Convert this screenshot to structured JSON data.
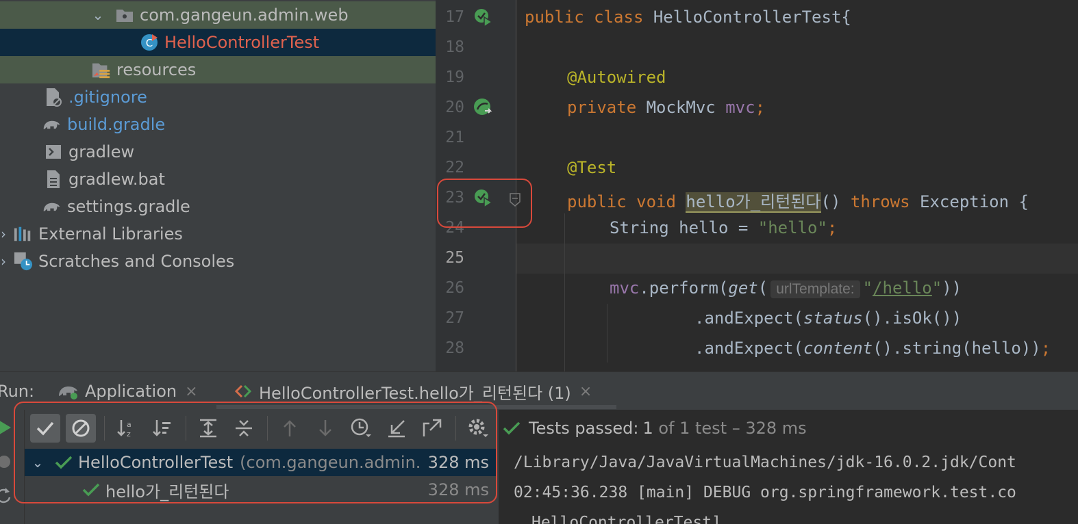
{
  "project_tree": {
    "items": [
      {
        "label": "com.gangeun.admin.web",
        "kind": "package"
      },
      {
        "label": "HelloControllerTest",
        "kind": "test-class"
      },
      {
        "label": "resources",
        "kind": "folder"
      },
      {
        "label": ".gitignore",
        "kind": "file"
      },
      {
        "label": "build.gradle",
        "kind": "gradle"
      },
      {
        "label": "gradlew",
        "kind": "script"
      },
      {
        "label": "gradlew.bat",
        "kind": "file"
      },
      {
        "label": "settings.gradle",
        "kind": "gradle"
      },
      {
        "label": "External Libraries",
        "kind": "libraries"
      },
      {
        "label": "Scratches and Consoles",
        "kind": "scratches"
      }
    ]
  },
  "editor": {
    "line_numbers": [
      "17",
      "18",
      "19",
      "20",
      "21",
      "22",
      "23",
      "24",
      "25",
      "26",
      "27",
      "28"
    ],
    "tokens": {
      "public": "public",
      "class": "class",
      "class_name": "HelloControllerTest{",
      "autowired": "@Autowired",
      "private": "private",
      "mockmvc": "MockMvc",
      "mvc_field": "mvc",
      "semicolon": ";",
      "test_ann": "@Test",
      "void": "void",
      "method_name": "hello가_리턴된다",
      "method_sig_rest": "() ",
      "throws": "throws",
      "exception": "Exception {",
      "string_type": "String hello = ",
      "hello_str": "\"hello\"",
      "mvc_call": "mvc",
      "perform": ".perform(",
      "get_fn": "get",
      "paren_open": "(",
      "hint_label": "urlTemplate:",
      "quote": "\"",
      "url": "/hello",
      "close_two": "))",
      "and_expect": ".andExpect(",
      "status_fn": "status",
      "is_ok": "().isOk())",
      "content_fn": "content",
      "string_call": "().string(hello))"
    }
  },
  "run": {
    "label": "Run:",
    "tabs": [
      {
        "label": "Application"
      },
      {
        "label": "HelloControllerTest.hello가_리턴된다 (1)"
      }
    ],
    "close_glyph": "×",
    "tests": [
      {
        "name": "HelloControllerTest",
        "package": "(com.gangeun.admin.",
        "time": "328 ms"
      },
      {
        "name": "hello가_리턴된다",
        "time": "328 ms"
      }
    ],
    "status_prefix": "Tests passed: ",
    "status_count": "1",
    "status_rest": " of 1 test – 328 ms",
    "console_lines": [
      "/Library/Java/JavaVirtualMachines/jdk-16.0.2.jdk/Cont",
      "02:45:36.238 [main] DEBUG org.springframework.test.co",
      "HelloControllerTest]"
    ]
  },
  "colors": {
    "accent_green": "#499c54",
    "annotation_red": "#d9493b"
  }
}
